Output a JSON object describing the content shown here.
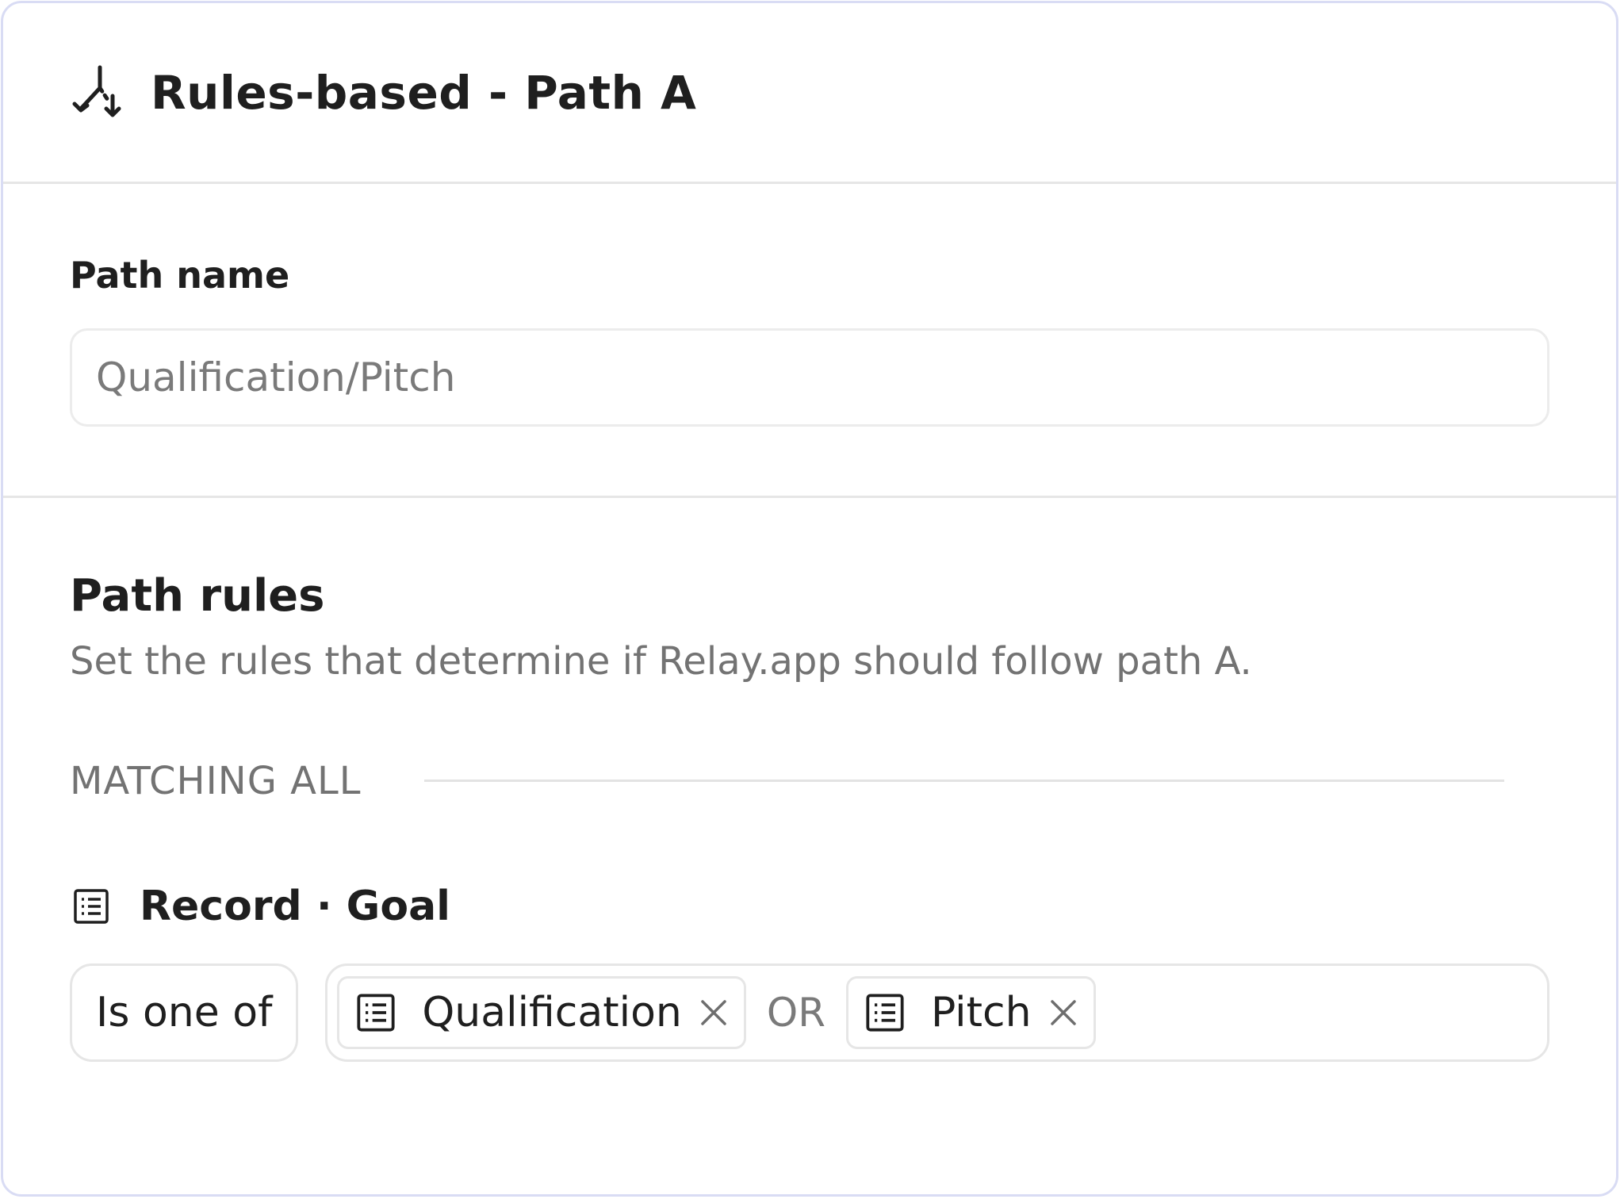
{
  "header": {
    "icon": "path-split-icon",
    "title": "Rules-based - Path A"
  },
  "path_name": {
    "label": "Path name",
    "placeholder": "Qualification/Pitch"
  },
  "path_rules": {
    "title": "Path rules",
    "description": "Set the rules that determine if Relay.app should follow path A.",
    "matching_label": "MATCHING ALL",
    "rule": {
      "field_icon": "list-icon",
      "field_label": "Record · Goal",
      "operator": "Is one of",
      "values": [
        {
          "icon": "list-icon",
          "label": "Qualification"
        },
        {
          "icon": "list-icon",
          "label": "Pitch"
        }
      ],
      "joiner": "OR"
    }
  },
  "colors": {
    "border": "#d9dcf4",
    "divider": "#e6e6e6",
    "text": "#1f1f1f",
    "muted": "#737373"
  }
}
